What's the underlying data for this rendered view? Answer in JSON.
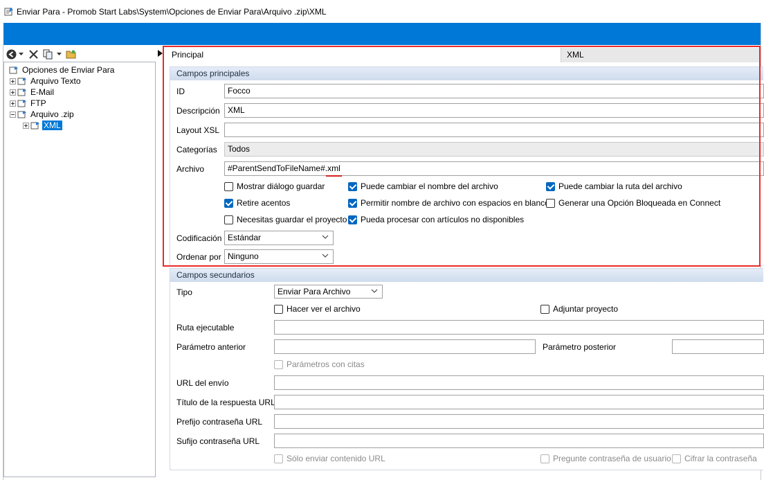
{
  "window": {
    "title": "Enviar Para - Promob Start Labs\\System\\Opciones de Enviar Para\\Arquivo .zip\\XML"
  },
  "colors": {
    "accent": "#0078d7",
    "highlight": "#e82b2b",
    "check": "#0067c0"
  },
  "toolbar": {
    "icons": [
      "back-icon",
      "dropdown-arrow-icon",
      "delete-icon",
      "copy-icon",
      "dropdown-arrow-icon",
      "folder-icon"
    ]
  },
  "tree": {
    "root": "Opciones de Enviar Para",
    "items": [
      {
        "label": "Arquivo Texto"
      },
      {
        "label": "E-Mail"
      },
      {
        "label": "FTP"
      },
      {
        "label": "Arquivo .zip"
      },
      {
        "label": "XML",
        "selected": true
      }
    ]
  },
  "tabs": {
    "principal": "Principal",
    "xml": "XML"
  },
  "main": {
    "header": "Campos principales",
    "id_label": "ID",
    "id_value": "Focco",
    "desc_label": "Descripción",
    "desc_value": "XML",
    "layout_label": "Layout XSL",
    "layout_value": "",
    "cat_label": "Categorías",
    "cat_value": "Todos",
    "archivo_label": "Archivo",
    "archivo_value": "#ParentSendToFileName#.xml",
    "checks": {
      "mostrar": "Mostrar diálogo guardar",
      "cambiar_nombre": "Puede cambiar el nombre del archivo",
      "cambiar_ruta": "Puede cambiar la ruta del archivo",
      "retire": "Retire acentos",
      "espacios": "Permitir nombre de archivo con espacios en blanco",
      "bloqueada": "Generar una Opción Bloqueada en Connect",
      "guardar": "Necesitas guardar el proyecto",
      "procesar": "Pueda procesar con artículos no disponibles"
    },
    "cod_label": "Codificación",
    "cod_value": "Estándar",
    "orden_label": "Ordenar por",
    "orden_value": "Ninguno"
  },
  "secondary": {
    "header": "Campos secundarios",
    "tipo_label": "Tipo",
    "tipo_value": "Enviar Para Archivo",
    "hacer_ver": "Hacer ver el archivo",
    "adjuntar": "Adjuntar proyecto",
    "ruta_label": "Ruta ejecutable",
    "param_ant_label": "Parámetro anterior",
    "param_post_label": "Parámetro posterior",
    "param_citas": "Parámetros con citas",
    "url_label": "URL del envío",
    "titulo_label": "Título de la respuesta URL",
    "prefijo_label": "Prefijo contraseña URL",
    "sufijo_label": "Sufijo contraseña URL",
    "solo_enviar": "Sólo enviar contenido URL",
    "pregunte": "Pregunte contraseña de usuario",
    "cifrar": "Cifrar la contraseña"
  }
}
